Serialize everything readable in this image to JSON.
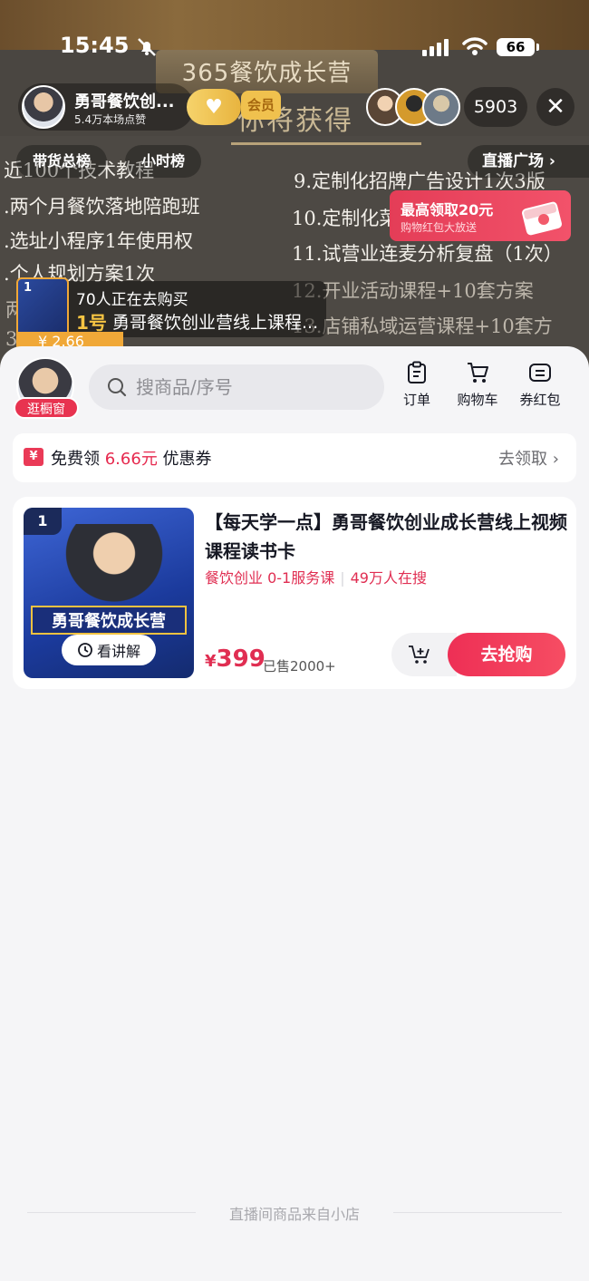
{
  "status_bar": {
    "time": "15:45",
    "battery": "66"
  },
  "stream": {
    "board_title": "365餐饮成长营",
    "board_subtitle": "你将获得",
    "board_left_lines": [
      "近100个技术教程",
      ".两个月餐饮落地陪跑班",
      ".选址小程序1年使用权",
      ".个人规划方案1次",
      "两",
      "3"
    ],
    "board_right_lines": [
      "9.定制化招牌广告设计1次3版",
      "10.定制化菜单设计1次",
      "11.试营业连麦分析复盘（1次）",
      "12.开业活动课程+10套方案",
      "13.店铺私域运营课程+10套方"
    ]
  },
  "host": {
    "name": "勇哥餐饮创...",
    "likes": "5.4万本场点赞",
    "fan_badge": "会员"
  },
  "viewers": {
    "count": "5903"
  },
  "rank_chips": [
    "带货总榜",
    "小时榜"
  ],
  "plaza": {
    "label": "直播广场 ›"
  },
  "redpack": {
    "title": "最高领取20元",
    "subtitle": "购物红包大放送"
  },
  "buyers": {
    "count_text": "70人正在去购买",
    "index": "1号",
    "product": "勇哥餐饮创业营线上课程...",
    "thumb_index": "1",
    "price_tab": "¥ 2.66"
  },
  "shop": {
    "tag": "逛橱窗"
  },
  "search": {
    "placeholder": "搜商品/序号"
  },
  "actions": [
    {
      "label": "订单",
      "icon": "order-icon"
    },
    {
      "label": "购物车",
      "icon": "cart-icon"
    },
    {
      "label": "券红包",
      "icon": "coupon-wallet-icon"
    }
  ],
  "coupon": {
    "prefix": "免费领",
    "amount": "6.66元",
    "suffix": "优惠券",
    "action": "去领取 ›",
    "icon": "¥"
  },
  "product": {
    "index": "1",
    "image_banner": "勇哥餐饮成长营",
    "explain": "看讲解",
    "title": "【每天学一点】勇哥餐饮创业成长营线上视频课程读书卡",
    "tag1": "餐饮创业 0-1服务课",
    "tag2": "49万人在搜",
    "price_currency": "¥",
    "price": "399",
    "sold": "已售2000+",
    "buy_label": "去抢购"
  },
  "footer": {
    "text": "直播间商品来自小店"
  },
  "colors": {
    "accent": "#e83350",
    "price": "#e02e52"
  }
}
